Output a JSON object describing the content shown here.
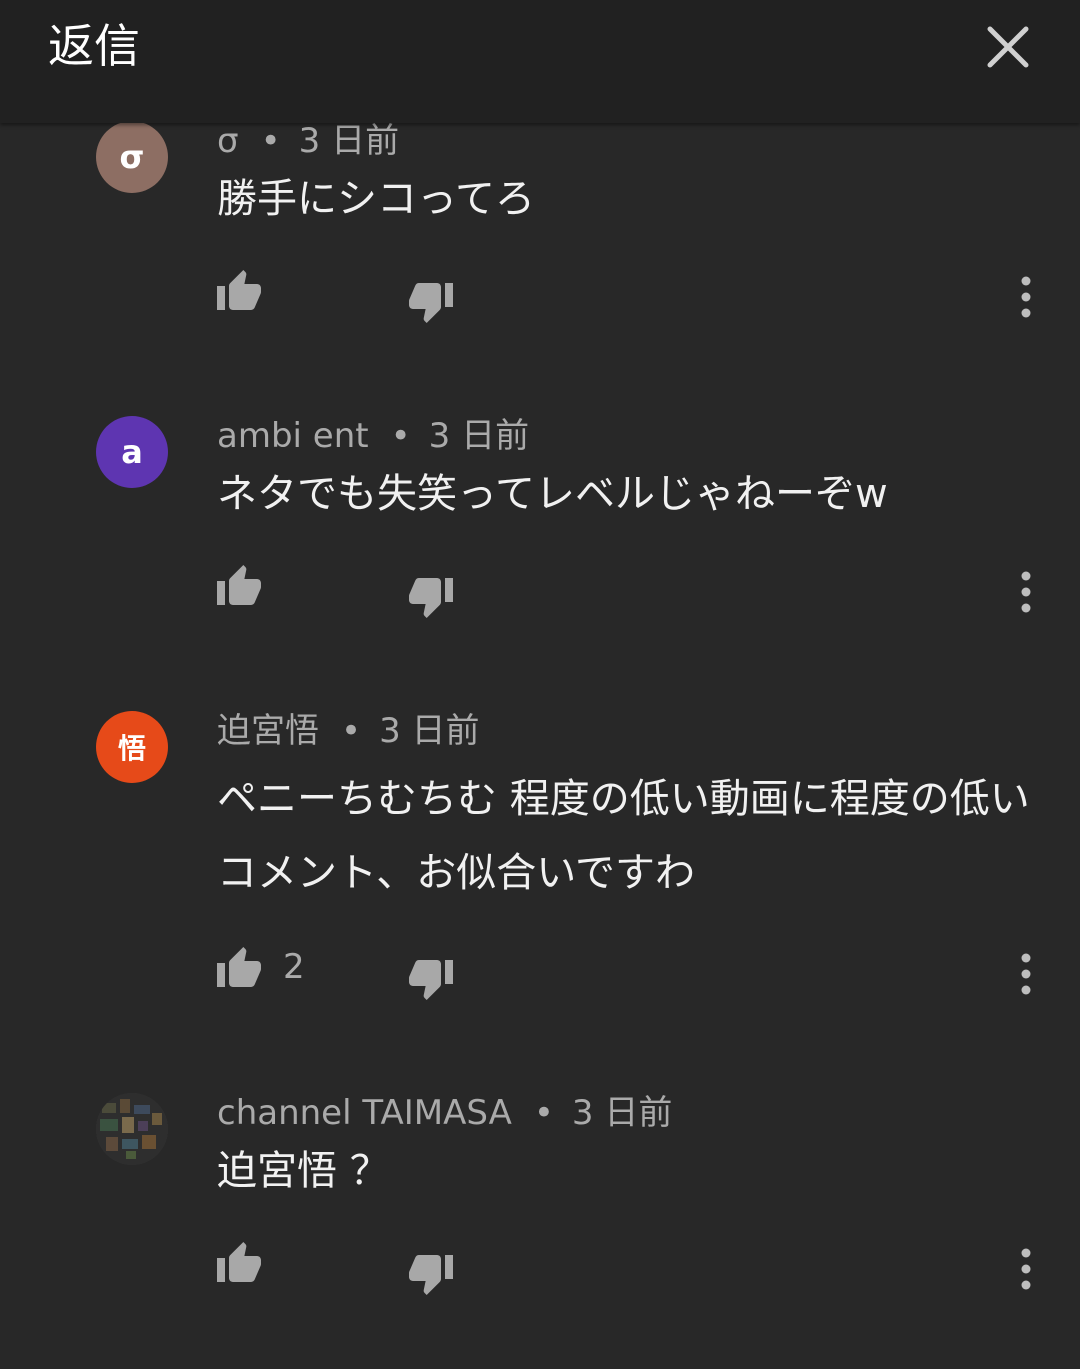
{
  "header": {
    "title": "返信"
  },
  "comments": [
    {
      "author": "σ",
      "avatar_letter": "σ",
      "avatar_color": "#8d6e63",
      "time": "3 日前",
      "text": "勝手にシコってろ",
      "likes": ""
    },
    {
      "author": "ambi ent",
      "avatar_letter": "a",
      "avatar_color": "#5e35b1",
      "time": "3 日前",
      "text": "ネタでも失笑ってレベルじゃねーぞw",
      "likes": ""
    },
    {
      "author": "迫宮悟",
      "avatar_letter": "悟",
      "avatar_color": "#e64a19",
      "time": "3 日前",
      "text": "ペニーちむちむ 程度の低い動画に程度の低いコメント、お似合いですわ",
      "likes": "2"
    },
    {
      "author": "channel TAIMASA",
      "avatar_letter": "",
      "avatar_color": "#3a3a3a",
      "time": "3 日前",
      "text": "迫宮悟 ？",
      "likes": ""
    }
  ],
  "separator": "•",
  "icons": {
    "close": "close-icon",
    "like": "thumb-up-icon",
    "dislike": "thumb-down-icon",
    "menu": "more-vert-icon"
  }
}
